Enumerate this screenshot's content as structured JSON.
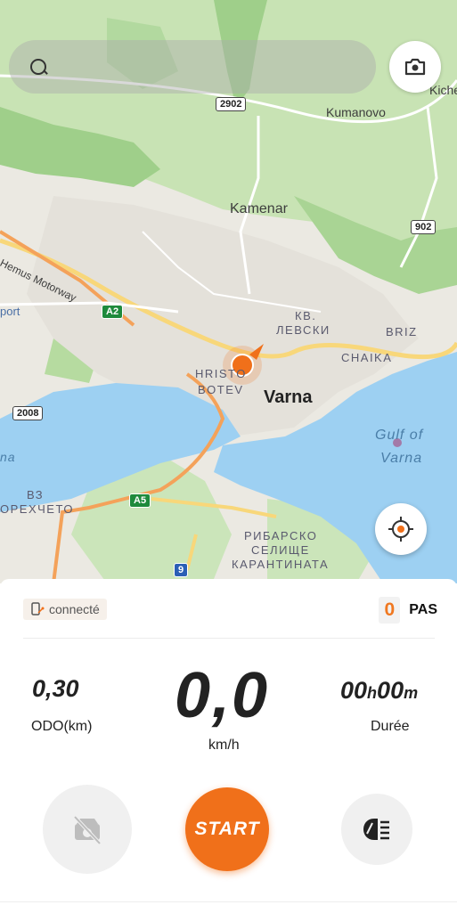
{
  "map": {
    "places": {
      "kumanovo": "Kumanovo",
      "kiche": "Kiche",
      "kamenar": "Kamenar",
      "varna": "Varna",
      "hristo": "HRISTO",
      "botev": "BOTEV",
      "kv": "КВ.",
      "levski": "ЛЕВСКИ",
      "briz": "BRIZ",
      "chaika": "CHAIKA",
      "gulf1": "Gulf of",
      "gulf2": "Varna",
      "motorway": "Hemus Motorway",
      "port": "port",
      "na": "na",
      "vz": "ВЗ",
      "orekhcheto": "ОРЕХЧЕТО",
      "ribarsko": "РИБАРСКО",
      "selishte": "СЕЛИЩЕ",
      "karantinata": "КАРАНТИНАТА"
    },
    "roads": {
      "r2902": "2902",
      "r902": "902",
      "r2008": "2008",
      "a2": "A2",
      "a5": "A5",
      "r9": "9"
    },
    "colors": {
      "water": "#9dd0f2",
      "green": "#b6dba0",
      "accent": "#f0701a"
    }
  },
  "status": {
    "connection": "connecté"
  },
  "pas": {
    "level": "0",
    "label": "PAS"
  },
  "stats": {
    "odo_value": "0,30",
    "odo_label": "ODO(km)",
    "speed_value": "0,0",
    "speed_label": "km/h",
    "duration_hours": "00",
    "duration_h": "h",
    "duration_minutes": "00",
    "duration_m": "m",
    "duration_label": "Durée"
  },
  "actions": {
    "start_label": "START"
  }
}
